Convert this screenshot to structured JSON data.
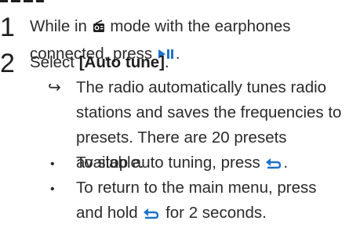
{
  "steps": [
    {
      "number": "1",
      "line1_before": "While in",
      "line1_after": "mode with the earphones",
      "line2_before": "connected, press",
      "line2_after": ".",
      "mode_icon": "radio-mode-icon",
      "play_pause_icon": "play-pause-icon"
    },
    {
      "number": "2",
      "text_before": "Select",
      "menu_option": "[Auto tune]",
      "text_after": ".",
      "result": {
        "arrow": "↪",
        "line1": "The radio automatically tunes radio",
        "line2": "stations and saves the frequencies to",
        "line3": "presets. There are 20 presets available."
      },
      "bullets": [
        {
          "marker": "•",
          "line1_before": "To stop auto tuning, press",
          "line1_after": ".",
          "icon": "back-icon"
        },
        {
          "marker": "•",
          "line1": "To return to the main menu, press",
          "line2_before": "and hold",
          "line2_after": "for 2 seconds.",
          "icon": "back-icon"
        }
      ]
    }
  ],
  "colors": {
    "text": "#2b2b2b",
    "icon_accent": "#1e73c8"
  }
}
